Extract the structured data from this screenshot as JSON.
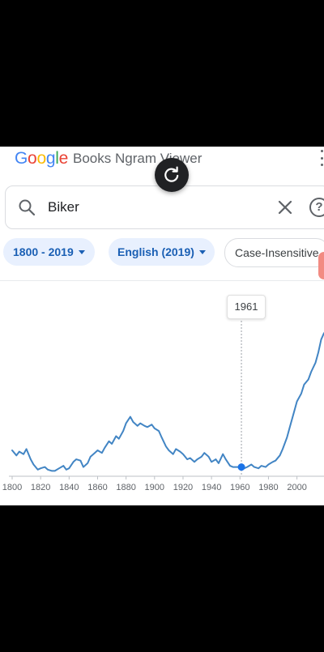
{
  "header": {
    "logo": [
      "G",
      "o",
      "o",
      "g",
      "l",
      "e"
    ],
    "logo_colors": [
      "#4285F4",
      "#EA4335",
      "#FBBC05",
      "#4285F4",
      "#34A853",
      "#EA4335"
    ],
    "app_title": "Books Ngram Viewer"
  },
  "search": {
    "value": "Biker",
    "icons": [
      "search-icon",
      "close-icon",
      "help-icon"
    ],
    "help_glyph": "?"
  },
  "filters": {
    "years": "1800 - 2019",
    "corpus": "English (2019)",
    "case": "Case-Insensitive"
  },
  "tooltip": {
    "year": "1961"
  },
  "colors": {
    "series": "#4285c4",
    "chip_bg": "#e8f0fe",
    "chip_text": "#1a5fb4",
    "accent_scroll": "#f28b82"
  },
  "chart_data": {
    "type": "line",
    "xlim": [
      1800,
      2019
    ],
    "ylim": [
      0,
      100
    ],
    "xticks": [
      1800,
      1820,
      1840,
      1860,
      1880,
      1900,
      1920,
      1940,
      1960,
      1980,
      2000
    ],
    "highlight_x": 1961,
    "series": [
      {
        "x": [
          1800,
          1803,
          1805,
          1808,
          1810,
          1813,
          1815,
          1818,
          1820,
          1823,
          1825,
          1828,
          1830,
          1833,
          1836,
          1838,
          1840,
          1843,
          1845,
          1848,
          1850,
          1853,
          1855,
          1858,
          1860,
          1863,
          1865,
          1868,
          1870,
          1873,
          1875,
          1878,
          1880,
          1883,
          1885,
          1888,
          1890,
          1893,
          1895,
          1898,
          1900,
          1903,
          1905,
          1908,
          1910,
          1913,
          1915,
          1918,
          1920,
          1923,
          1925,
          1928,
          1930,
          1933,
          1935,
          1938,
          1940,
          1943,
          1945,
          1948,
          1950,
          1953,
          1955,
          1958,
          1961,
          1963,
          1965,
          1968,
          1970,
          1973,
          1975,
          1978,
          1980,
          1983,
          1985,
          1988,
          1990,
          1993,
          1995,
          1998,
          2000,
          2003,
          2005,
          2008,
          2010,
          2013,
          2015,
          2017,
          2019
        ],
        "y": [
          17,
          13,
          16,
          14,
          18,
          10,
          6,
          2,
          3,
          4,
          2,
          1,
          1,
          3,
          5,
          2,
          3,
          8,
          10,
          9,
          4,
          7,
          12,
          15,
          17,
          15,
          19,
          24,
          22,
          28,
          26,
          32,
          38,
          43,
          39,
          36,
          38,
          36,
          35,
          37,
          34,
          32,
          27,
          20,
          17,
          14,
          18,
          16,
          14,
          10,
          11,
          8,
          10,
          12,
          15,
          12,
          8,
          10,
          7,
          14,
          10,
          5,
          4,
          4,
          4,
          3,
          4,
          6,
          4,
          3,
          5,
          4,
          6,
          8,
          9,
          13,
          18,
          27,
          35,
          47,
          55,
          61,
          68,
          72,
          78,
          85,
          93,
          103,
          108
        ]
      }
    ]
  }
}
